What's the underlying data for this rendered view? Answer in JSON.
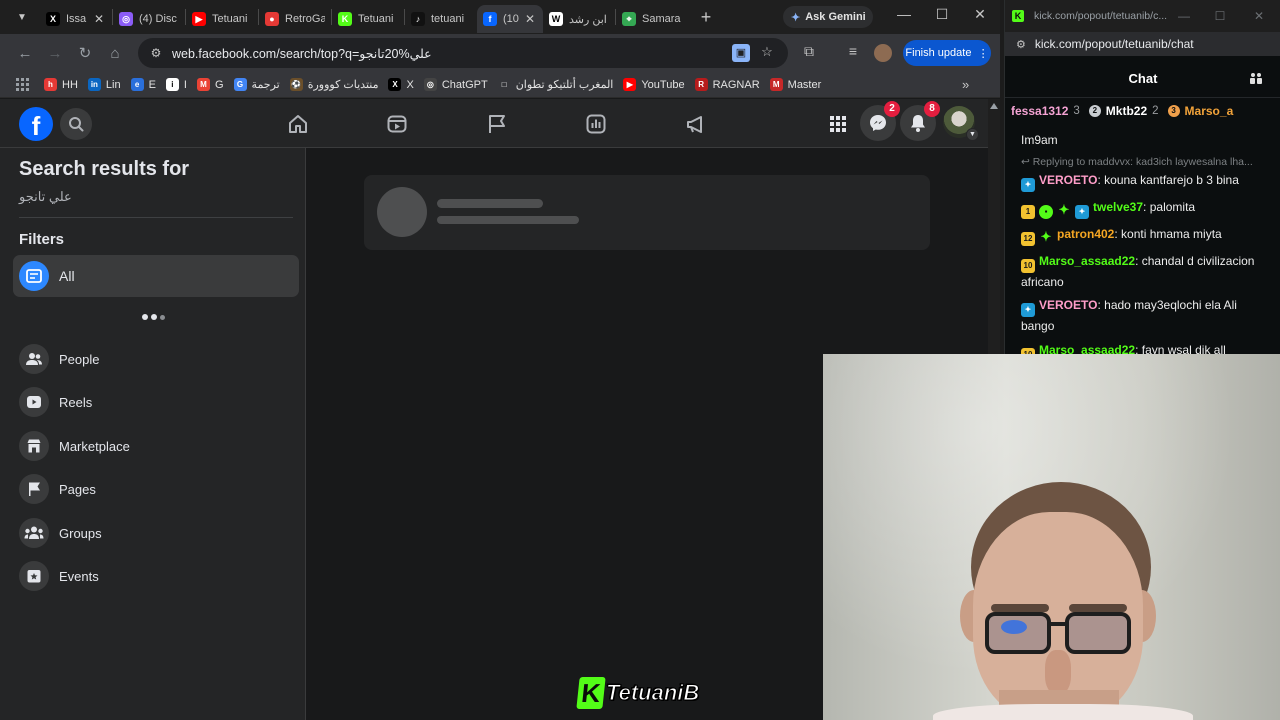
{
  "browser": {
    "tabs": [
      {
        "label": "Issa",
        "fav": "X",
        "color": "#000000"
      },
      {
        "label": "(4) Disc",
        "fav": "◎",
        "color": "#8b5cf6"
      },
      {
        "label": "Tetuani",
        "fav": "▶",
        "color": "#ff0000"
      },
      {
        "label": "RetroGa",
        "fav": "●",
        "color": "#e53935"
      },
      {
        "label": "Tetuani",
        "fav": "K",
        "color": "#53fc18"
      },
      {
        "label": "tetuani",
        "fav": "♪",
        "color": "#111111"
      },
      {
        "label": "(10",
        "fav": "f",
        "color": "#0866ff"
      },
      {
        "label": "ابن رشد",
        "fav": "W",
        "color": "#ffffff"
      },
      {
        "label": "Samara",
        "fav": "⌖",
        "color": "#34a853"
      }
    ],
    "ask_gemini": "Ask Gemini",
    "url": "web.facebook.com/search/top?q=علي%20تانجو",
    "finish_update": "Finish update",
    "bookmarks": [
      {
        "label": "HH",
        "fav": "h",
        "color": "#e53935"
      },
      {
        "label": "Lin",
        "fav": "in",
        "color": "#0a66c2"
      },
      {
        "label": "E",
        "fav": "e",
        "color": "#2a6fdb"
      },
      {
        "label": "I",
        "fav": "i",
        "color": "#ffffff"
      },
      {
        "label": "G",
        "fav": "M",
        "color": "#ea4335"
      },
      {
        "label": "ترجمة",
        "fav": "G",
        "color": "#4285f4"
      },
      {
        "label": "منتديات كووورة",
        "fav": "⚽",
        "color": "#6b4f2a"
      },
      {
        "label": "X",
        "fav": "X",
        "color": "#000000"
      },
      {
        "label": "ChatGPT",
        "fav": "◎",
        "color": "#444444"
      },
      {
        "label": "المغرب أتلتيكو تطوان",
        "fav": "□",
        "color": "#35363a"
      },
      {
        "label": "YouTube",
        "fav": "▶",
        "color": "#ff0000"
      },
      {
        "label": "RAGNAR",
        "fav": "R",
        "color": "#b71c1c"
      },
      {
        "label": "Master",
        "fav": "M",
        "color": "#c62828"
      }
    ]
  },
  "facebook": {
    "logo": "f",
    "badges": {
      "messenger": "2",
      "notifications": "8"
    },
    "search_results_title": "Search results for",
    "query": "علي تانجو",
    "filters_title": "Filters",
    "filters": [
      {
        "label": "All",
        "icon": "feed-icon"
      },
      {
        "label": "People",
        "icon": "people-icon"
      },
      {
        "label": "Reels",
        "icon": "reels-icon"
      },
      {
        "label": "Marketplace",
        "icon": "marketplace-icon"
      },
      {
        "label": "Pages",
        "icon": "flag-icon"
      },
      {
        "label": "Groups",
        "icon": "groups-icon"
      },
      {
        "label": "Events",
        "icon": "calendar-star-icon"
      }
    ]
  },
  "overlay": {
    "watermark_k": "K",
    "watermark_text": "TetuaniB"
  },
  "kick": {
    "window_title": "kick.com/popout/tetuanib/c...",
    "url": "kick.com/popout/tetuanib/chat",
    "chat_title": "Chat",
    "leaderboard": [
      {
        "name": "fessa1312",
        "count": "3",
        "color": "#f5a3d4",
        "medal": ""
      },
      {
        "name": "Mktb22",
        "count": "2",
        "color": "#ffffff",
        "medal": "2"
      },
      {
        "name": "Marso_a",
        "count": "",
        "color": "#f2a33a",
        "medal": "3"
      }
    ],
    "messages": [
      {
        "user": "",
        "text": "Im9am",
        "color": "#ffffff",
        "badges": []
      },
      {
        "reply": "Replying to maddvvx: kad3ich laywesalna lha..."
      },
      {
        "user": "VEROETO",
        "text": "kouna kantfarejo b 3 bina",
        "color": "#ff9ec9",
        "badges": [
          "vip"
        ]
      },
      {
        "user": "twelve37",
        "text": "palomita",
        "color": "#53fc18",
        "badges": [
          "1",
          "sub",
          "og",
          "vip"
        ]
      },
      {
        "user": "patron402",
        "text": "konti hmama miyta",
        "color": "#f5a623",
        "badges": [
          "12",
          "og"
        ]
      },
      {
        "user": "Marso_assaad22",
        "text": "chandal d civilizacion africano",
        "color": "#53fc18",
        "badges": [
          "10"
        ]
      },
      {
        "user": "VEROETO",
        "text": "hado may3eqlochi ela Ali bango",
        "color": "#ff9ec9",
        "badges": [
          "vip"
        ]
      },
      {
        "user": "Marso_assaad22",
        "text": "fayn wsal dik all",
        "color": "#53fc18",
        "badges": [
          "10"
        ]
      }
    ]
  }
}
